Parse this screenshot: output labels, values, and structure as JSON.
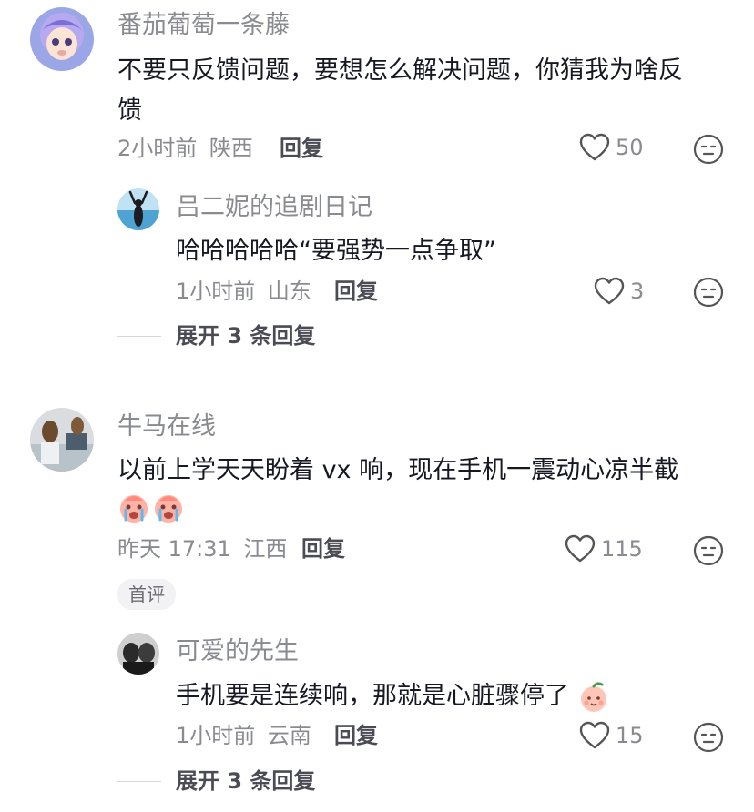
{
  "comments": [
    {
      "username": "番茄葡萄一条藤",
      "text_line1": "不要只反馈问题，要想怎么解决问题，你猜我为啥反",
      "text_line2": "馈",
      "time": "2小时前",
      "location": "陕西",
      "reply_label": "回复",
      "likes": "50",
      "replies": [
        {
          "username": "吕二妮的追剧日记",
          "text": "哈哈哈哈哈“要强势一点争取”",
          "time": "1小时前",
          "location": "山东",
          "reply_label": "回复",
          "likes": "3"
        }
      ],
      "expand_label": "展开 3 条回复"
    },
    {
      "username": "牛马在线",
      "text_line1": "以前上学天天盼着 vx 响，现在手机一震动心凉半截",
      "emoji": "crying-face-emoji",
      "time": "昨天 17:31",
      "location": "江西",
      "reply_label": "回复",
      "likes": "115",
      "badge": "首评",
      "replies": [
        {
          "username": "可爱的先生",
          "text": "手机要是连续响，那就是心脏骤停了",
          "emoji": "peach-face-emoji",
          "time": "1小时前",
          "location": "云南",
          "reply_label": "回复",
          "likes": "15"
        }
      ],
      "expand_label": "展开 3 条回复"
    }
  ]
}
